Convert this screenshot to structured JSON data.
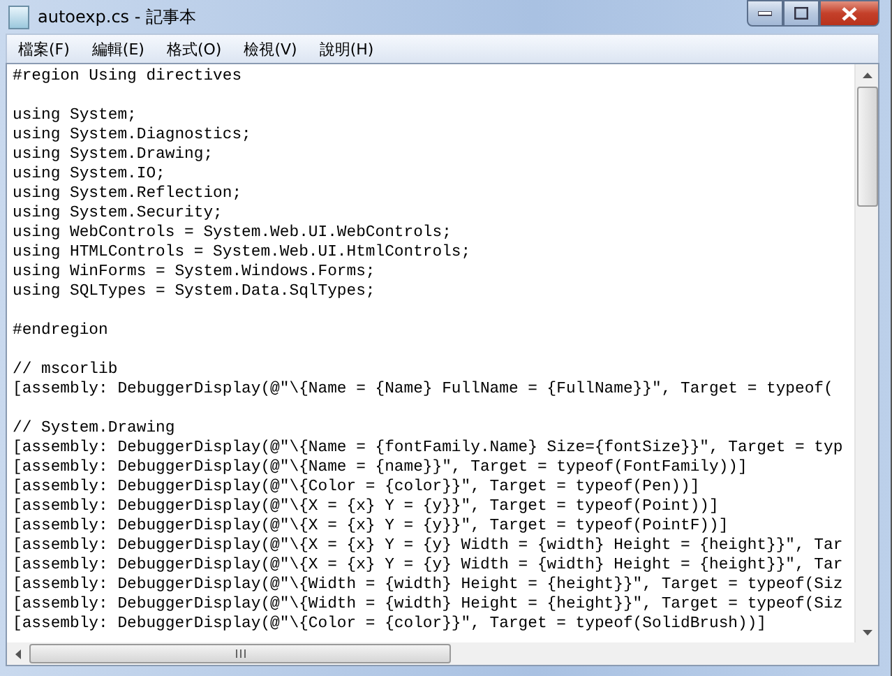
{
  "window": {
    "title": "autoexp.cs - 記事本"
  },
  "menu": [
    "檔案(F)",
    "編輯(E)",
    "格式(O)",
    "檢視(V)",
    "說明(H)"
  ],
  "editor": {
    "blocks": [
      [
        "#region Using directives"
      ],
      [
        "using System;",
        "using System.Diagnostics;",
        "using System.Drawing;",
        "using System.IO;",
        "using System.Reflection;",
        "using System.Security;",
        "using WebControls = System.Web.UI.WebControls;",
        "using HTMLControls = System.Web.UI.HtmlControls;",
        "using WinForms = System.Windows.Forms;",
        "using SQLTypes = System.Data.SqlTypes;"
      ],
      [
        "#endregion"
      ],
      [
        "// mscorlib",
        "[assembly: DebuggerDisplay(@\"\\{Name = {Name} FullName = {FullName}}\", Target = typeof("
      ],
      [
        "// System.Drawing",
        "[assembly: DebuggerDisplay(@\"\\{Name = {fontFamily.Name} Size={fontSize}}\", Target = typ",
        "[assembly: DebuggerDisplay(@\"\\{Name = {name}}\", Target = typeof(FontFamily))]",
        "[assembly: DebuggerDisplay(@\"\\{Color = {color}}\", Target = typeof(Pen))]",
        "[assembly: DebuggerDisplay(@\"\\{X = {x} Y = {y}}\", Target = typeof(Point))]",
        "[assembly: DebuggerDisplay(@\"\\{X = {x} Y = {y}}\", Target = typeof(PointF))]",
        "[assembly: DebuggerDisplay(@\"\\{X = {x} Y = {y} Width = {width} Height = {height}}\", Tar",
        "[assembly: DebuggerDisplay(@\"\\{X = {x} Y = {y} Width = {width} Height = {height}}\", Tar",
        "[assembly: DebuggerDisplay(@\"\\{Width = {width} Height = {height}}\", Target = typeof(Siz",
        "[assembly: DebuggerDisplay(@\"\\{Width = {width} Height = {height}}\", Target = typeof(Siz",
        "[assembly: DebuggerDisplay(@\"\\{Color = {color}}\", Target = typeof(SolidBrush))]"
      ]
    ]
  }
}
